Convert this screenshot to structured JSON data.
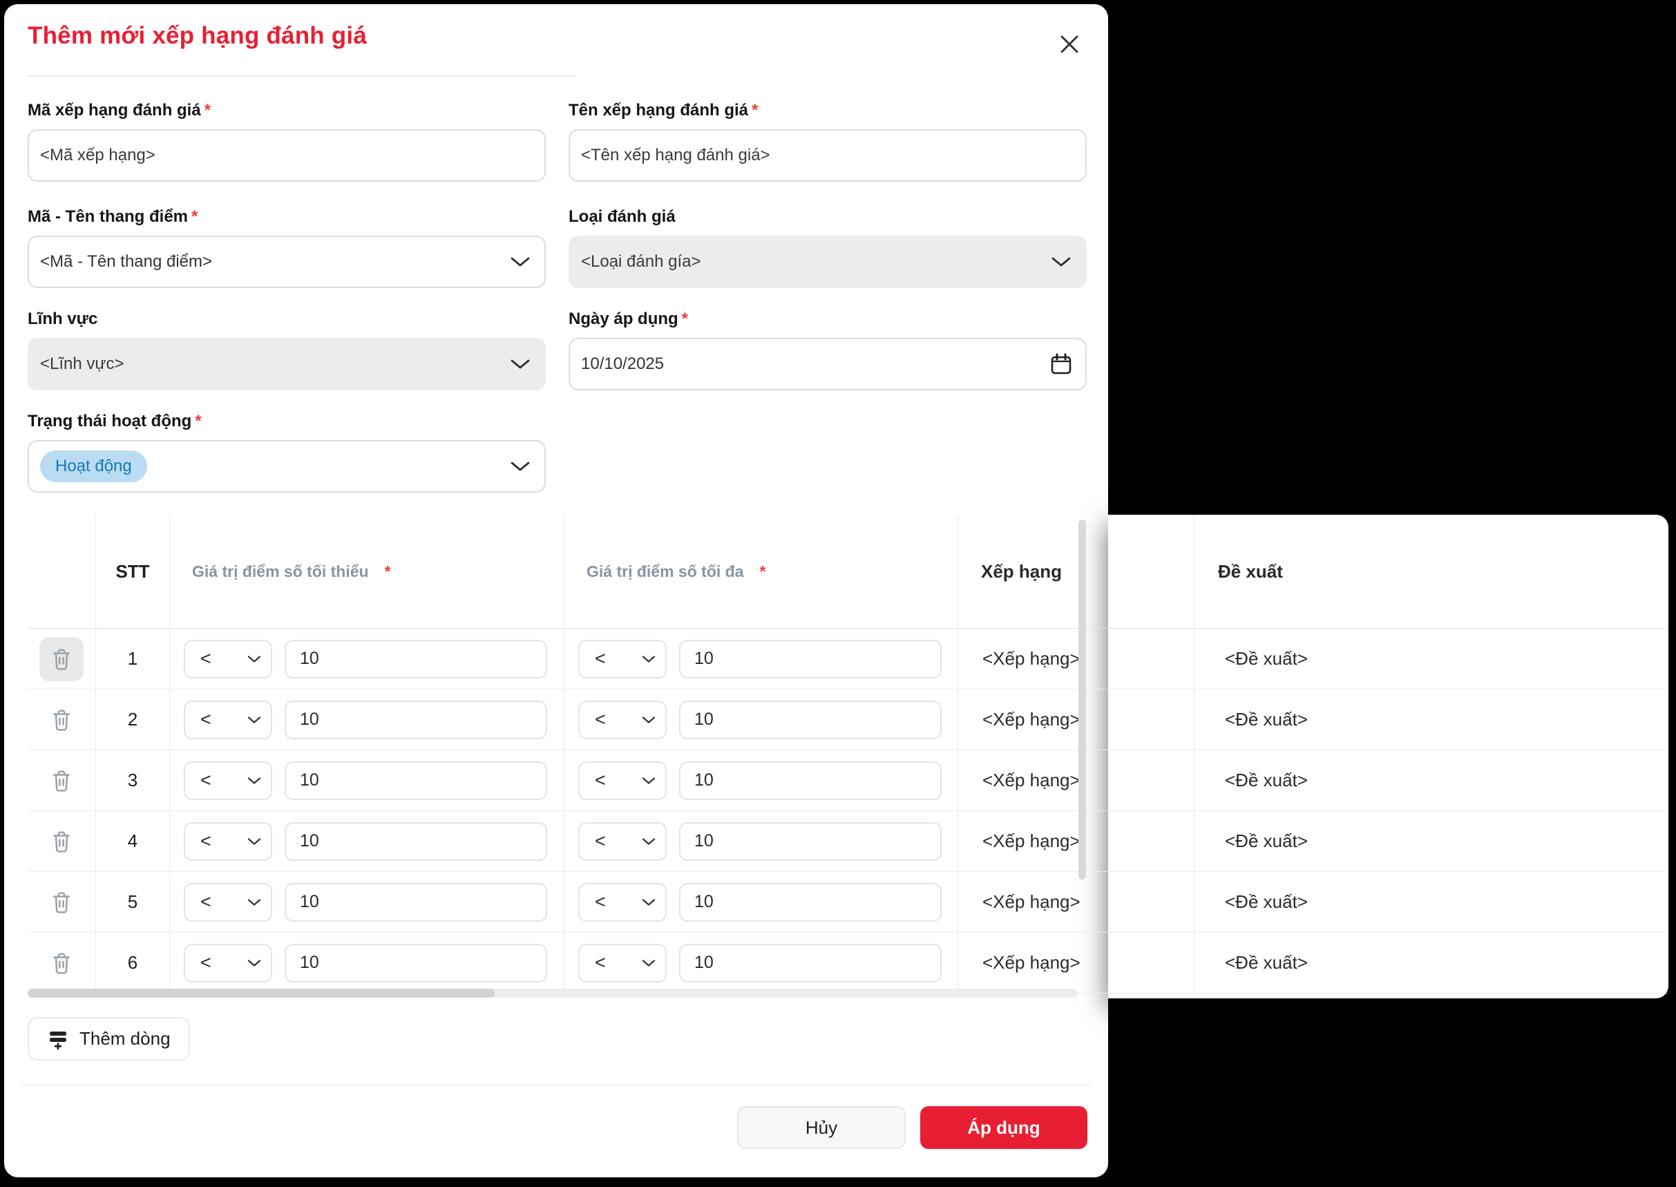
{
  "dialog": {
    "title": "Thêm mới xếp hạng đánh giá"
  },
  "form": {
    "code": {
      "label": "Mã xếp hạng đánh giá",
      "required_star": "*",
      "placeholder": "<Mã xếp hạng>"
    },
    "name": {
      "label": "Tên xếp hạng đánh giá",
      "required_star": "*",
      "placeholder": "<Tên xếp hạng đánh giá>"
    },
    "scale": {
      "label": "Mã - Tên thang điểm",
      "required_star": "*",
      "placeholder": "<Mã - Tên thang điểm>"
    },
    "type": {
      "label": "Loại đánh giá",
      "placeholder": "<Loại đánh gía>"
    },
    "area": {
      "label": "Lĩnh vực",
      "placeholder": "<Lĩnh vực>"
    },
    "date": {
      "label": "Ngày áp dụng",
      "required_star": "*",
      "value": "10/10/2025"
    },
    "status": {
      "label": "Trạng thái hoạt động",
      "required_star": "*",
      "chip": "Hoạt động"
    }
  },
  "table": {
    "headers": {
      "stt": "STT",
      "min": "Giá trị điểm số tối thiểu",
      "min_star": "*",
      "max": "Giá trị điểm số tối đa",
      "max_star": "*",
      "rank": "Xếp hạng",
      "proposal": "Đề xuất"
    },
    "rows": [
      {
        "stt": "1",
        "min_op": "<",
        "min_value": "10",
        "max_op": "<",
        "max_value": "10",
        "rank": "<Xếp hạng>",
        "proposal": "<Đề xuất>"
      },
      {
        "stt": "2",
        "min_op": "<",
        "min_value": "10",
        "max_op": "<",
        "max_value": "10",
        "rank": "<Xếp hạng>",
        "proposal": "<Đề xuất>"
      },
      {
        "stt": "3",
        "min_op": "<",
        "min_value": "10",
        "max_op": "<",
        "max_value": "10",
        "rank": "<Xếp hạng>",
        "proposal": "<Đề xuất>"
      },
      {
        "stt": "4",
        "min_op": "<",
        "min_value": "10",
        "max_op": "<",
        "max_value": "10",
        "rank": "<Xếp hạng>",
        "proposal": "<Đề xuất>"
      },
      {
        "stt": "5",
        "min_op": "<",
        "min_value": "10",
        "max_op": "<",
        "max_value": "10",
        "rank": "<Xếp hạng>",
        "proposal": "<Đề xuất>"
      },
      {
        "stt": "6",
        "min_op": "<",
        "min_value": "10",
        "max_op": "<",
        "max_value": "10",
        "rank": "<Xếp hạng>",
        "proposal": "<Đề xuất>"
      }
    ]
  },
  "actions": {
    "add_row": "Thêm dòng",
    "cancel": "Hủy",
    "apply": "Áp dụng"
  },
  "colors": {
    "accent_red": "#e81f33",
    "asterisk_red": "#f43b3b",
    "chip_bg": "#b9dcf2",
    "chip_text": "#1878b6",
    "header_text": "#8b93a3"
  }
}
